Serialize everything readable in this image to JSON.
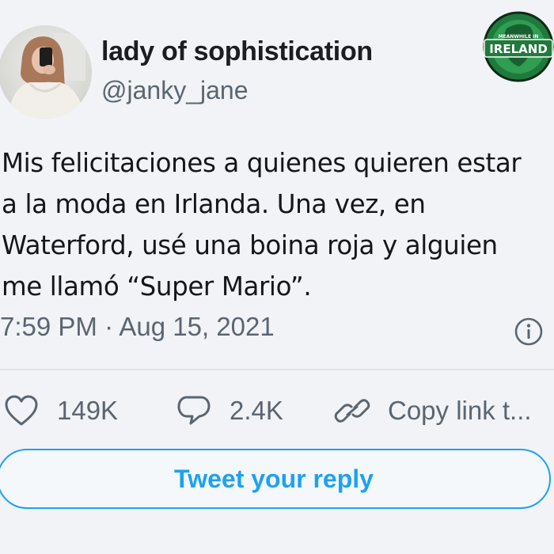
{
  "user": {
    "display_name": "lady of sophistication",
    "handle": "@janky_jane"
  },
  "watermark": {
    "top_text": "MEANWHILE IN",
    "main_text": "IRELAND"
  },
  "tweet": {
    "lines": [
      "Mis felicitaciones a quienes quieren estar",
      "a la moda en Irlanda. Una vez, en",
      "Waterford, usé una boina roja y alguien",
      "me llamó “Super Mario”."
    ],
    "timestamp": "7:59 PM · Aug 15, 2021"
  },
  "actions": {
    "likes": "149K",
    "replies": "2.4K",
    "copy_link": "Copy link t..."
  },
  "reply": {
    "label": "Tweet your reply"
  },
  "icons": {
    "like": "heart-icon",
    "reply": "speech-bubble-icon",
    "copy": "link-icon",
    "info": "info-icon"
  },
  "colors": {
    "accent": "#1da1f2",
    "secondary_text": "#5b6570",
    "background": "#f1f3f6",
    "watermark_green": "#1f7a3c"
  }
}
